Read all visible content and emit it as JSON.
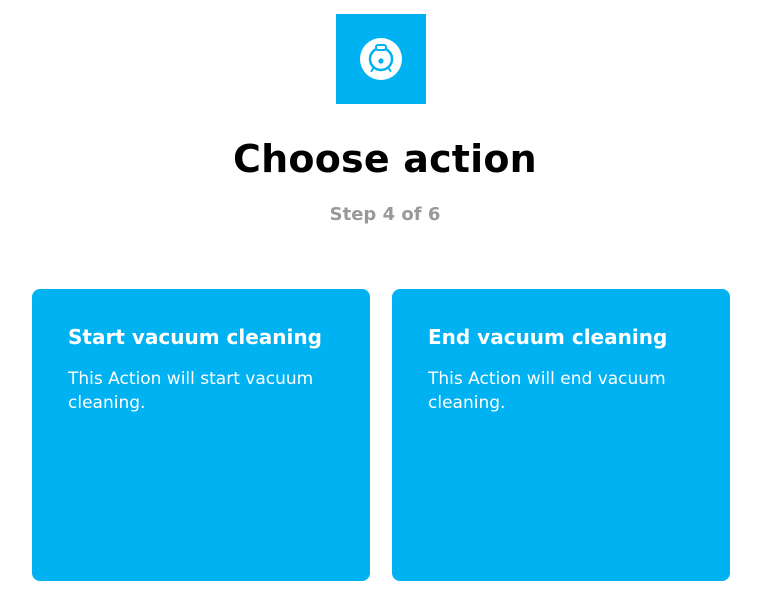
{
  "service": {
    "icon": "robot-vacuum-icon",
    "brand_color": "#00b2f2"
  },
  "header": {
    "title": "Choose action",
    "step": "Step 4 of 6"
  },
  "actions": [
    {
      "title": "Start vacuum cleaning",
      "description": "This Action will start vacuum cleaning."
    },
    {
      "title": "End vacuum cleaning",
      "description": "This Action will end vacuum cleaning."
    }
  ]
}
